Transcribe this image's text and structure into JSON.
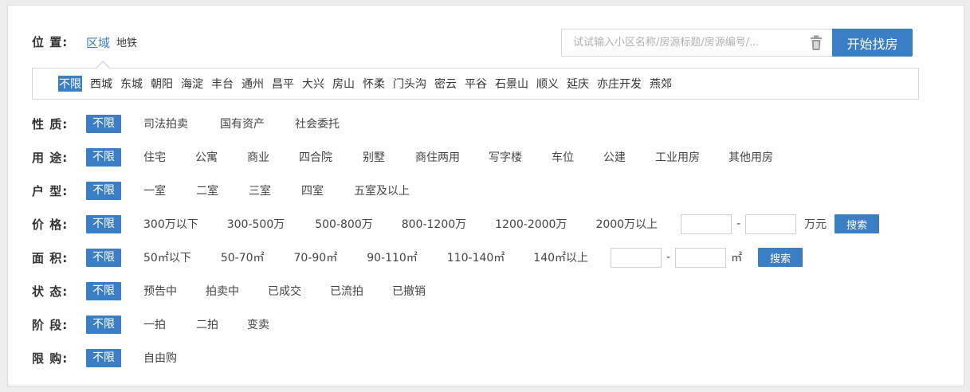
{
  "location": {
    "label": "位 置:",
    "tab_area": "区域",
    "tab_subway": "地铁",
    "search_placeholder": "试试输入小区名称/房源标题/房源编号/...",
    "search_button": "开始找房",
    "districts": [
      "不限",
      "西城",
      "东城",
      "朝阳",
      "海淀",
      "丰台",
      "通州",
      "昌平",
      "大兴",
      "房山",
      "怀柔",
      "门头沟",
      "密云",
      "平谷",
      "石景山",
      "顺义",
      "延庆",
      "亦庄开发",
      "燕郊"
    ],
    "active_district": "不限"
  },
  "filters": {
    "nature": {
      "label": "性 质:",
      "options": [
        "不限",
        "司法拍卖",
        "国有资产",
        "社会委托"
      ]
    },
    "usage": {
      "label": "用 途:",
      "options": [
        "不限",
        "住宅",
        "公寓",
        "商业",
        "四合院",
        "别墅",
        "商住两用",
        "写字楼",
        "车位",
        "公建",
        "工业用房",
        "其他用房"
      ]
    },
    "layout": {
      "label": "户 型:",
      "options": [
        "不限",
        "一室",
        "二室",
        "三室",
        "四室",
        "五室及以上"
      ]
    },
    "price": {
      "label": "价 格:",
      "options": [
        "不限",
        "300万以下",
        "300-500万",
        "500-800万",
        "800-1200万",
        "1200-2000万",
        "2000万以上"
      ],
      "unit": "万元",
      "dash": "-",
      "button": "搜索"
    },
    "area": {
      "label": "面 积:",
      "options": [
        "不限",
        "50㎡以下",
        "50-70㎡",
        "70-90㎡",
        "90-110㎡",
        "110-140㎡",
        "140㎡以上"
      ],
      "unit": "㎡",
      "dash": "-",
      "button": "搜索"
    },
    "status": {
      "label": "状 态:",
      "options": [
        "不限",
        "预告中",
        "拍卖中",
        "已成交",
        "已流拍",
        "已撤销"
      ]
    },
    "stage": {
      "label": "阶 段:",
      "options": [
        "不限",
        "一拍",
        "二拍",
        "变卖"
      ]
    },
    "purchase_limit": {
      "label": "限 购:",
      "options": [
        "不限",
        "自由购"
      ]
    }
  },
  "colors": {
    "accent": "#3a7ec6",
    "border": "#d7d7d7",
    "background": "#ededed"
  }
}
